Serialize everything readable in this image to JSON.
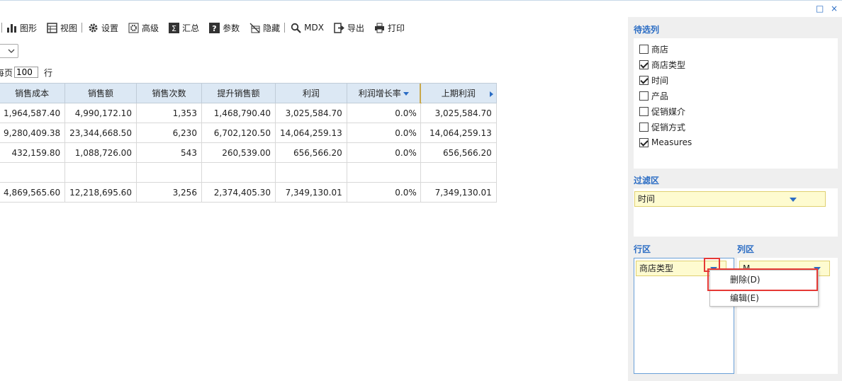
{
  "window": {
    "restore_glyph": "□",
    "close_glyph": "×"
  },
  "toolbar": {
    "items": [
      {
        "label": "图形",
        "icon": "bar-chart-icon"
      },
      {
        "label": "视图",
        "icon": "grid-view-icon"
      },
      {
        "label": "设置",
        "icon": "gear-icon"
      },
      {
        "label": "高级",
        "icon": "advanced-gear-icon"
      },
      {
        "label": "汇总",
        "icon": "sigma-icon"
      },
      {
        "label": "参数",
        "icon": "question-icon"
      },
      {
        "label": "隐藏",
        "icon": "hide-icon"
      },
      {
        "label": "MDX",
        "icon": "search-icon"
      },
      {
        "label": "导出",
        "icon": "export-icon"
      },
      {
        "label": "打印",
        "icon": "print-icon"
      }
    ]
  },
  "pager": {
    "prefix": "每页",
    "page_size": "100",
    "suffix": "行"
  },
  "table": {
    "columns": [
      "销售成本",
      "销售额",
      "销售次数",
      "提升销售额",
      "利润",
      "利润增长率",
      "上期利润"
    ],
    "rows": [
      [
        "1,964,587.40",
        "4,990,172.10",
        "1,353",
        "1,468,790.40",
        "3,025,584.70",
        "0.0%",
        "3,025,584.70"
      ],
      [
        "9,280,409.38",
        "23,344,668.50",
        "6,230",
        "6,702,120.50",
        "14,064,259.13",
        "0.0%",
        "14,064,259.13"
      ],
      [
        "432,159.80",
        "1,088,726.00",
        "543",
        "260,539.00",
        "656,566.20",
        "0.0%",
        "656,566.20"
      ],
      [
        "",
        "",
        "",
        "",
        "",
        "",
        ""
      ],
      [
        "4,869,565.60",
        "12,218,695.60",
        "3,256",
        "2,374,405.30",
        "7,349,130.01",
        "0.0%",
        "7,349,130.01"
      ]
    ]
  },
  "panel": {
    "candidates_title": "待选列",
    "candidates": [
      {
        "label": "商店",
        "checked": false
      },
      {
        "label": "商店类型",
        "checked": true
      },
      {
        "label": "时间",
        "checked": true
      },
      {
        "label": "产品",
        "checked": false
      },
      {
        "label": "促销媒介",
        "checked": false
      },
      {
        "label": "促销方式",
        "checked": false
      },
      {
        "label": "Measures",
        "checked": true
      }
    ],
    "filter_title": "过滤区",
    "filter_chip": "时间",
    "row_title": "行区",
    "row_chip": "商店类型",
    "col_title": "列区",
    "col_chip": "M"
  },
  "context_menu": {
    "delete": "删除(D)",
    "edit": "编辑(E)"
  },
  "colors": {
    "accent": "#2a6cc4",
    "header_bg": "#dce8f4",
    "chip_bg": "#fefbd0",
    "highlight": "#e53935"
  }
}
